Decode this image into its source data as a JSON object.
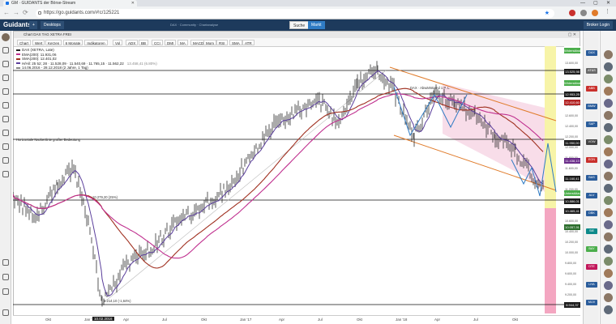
{
  "browser": {
    "tab_title": "GM · GUIDANTS der Börse-Stream",
    "url": "https://go.guidants.com/#!c/125221",
    "ctl_min": "—",
    "ctl_max": "▢",
    "ctl_close": "✕",
    "nav_back": "←",
    "nav_fwd": "→",
    "nav_reload": "⟳",
    "star": "★"
  },
  "app": {
    "logo": "Guidants",
    "add": "+",
    "desktops": "Desktops",
    "notice": "DAX · Community · Chartanalyse",
    "search": "Suche",
    "market": "Markt",
    "broker": "Broker Login"
  },
  "chart": {
    "window_title": "Chart DAX TAG XETRA FREI",
    "win_controls": "▢ ✕",
    "toolbar": [
      "Chart",
      "Wert",
      "Kerzen",
      "6 Monate",
      "Indikatoren",
      "Vol",
      "ADX",
      "BB",
      "CCI",
      "DMI",
      "MA",
      "MACD",
      "Mom",
      "RSI",
      "SMA",
      "ATR"
    ],
    "legend": {
      "name": "DAX (XETRA, Late)",
      "ema200": "EMA(200): 11.931,06",
      "sma200": "SMA(200): 12.401,02",
      "ohlc": "H/Hil: 25 52; 28 · 11.528,09 · 11.540,69 · 11.765,15 · 11.562,22",
      "period": "14.06.2016 - 28.12.2018 (2 Jahre, 1 Tag)",
      "extra": "13.458,41 (6.80%)"
    },
    "annotations": {
      "resistance": "Horizontale Nackenlinie großer Bedeutung",
      "channel": "DAX · Abwärtstrend 1 P. L.",
      "low_label": "9.214,10 (-1,64%)",
      "mid_label": "10.279,20 (25%)",
      "date_label": "10.02.2016"
    },
    "x_labels": [
      "Okt",
      "Jan '16",
      "Apr",
      "Jul",
      "Okt",
      "Jan '17",
      "Apr",
      "Jul",
      "Okt",
      "Jan '18",
      "Apr",
      "Jul",
      "Okt"
    ],
    "price_tags": [
      {
        "label": "Widerstände",
        "color": "#4cae4c"
      },
      {
        "label": "13.525,98",
        "color": "#1d1d1d"
      },
      {
        "label": "Widerstände",
        "color": "#4cae4c"
      },
      {
        "label": "12.953,25",
        "color": "#1d1d1d"
      },
      {
        "label": "12.410,60",
        "color": "#b32424"
      },
      {
        "label": "11.950,00",
        "color": "#1d1d1d"
      },
      {
        "label": "11.438,13",
        "color": "#6b2e8a"
      },
      {
        "label": "11.160,41",
        "color": "#1d1d1d"
      },
      {
        "label": "Unterstützung",
        "color": "#4cae4c"
      },
      {
        "label": "10.886,01",
        "color": "#1d1d1d"
      },
      {
        "label": "10.465,41",
        "color": "#1d1d1d"
      },
      {
        "label": "10.057,91",
        "color": "#2d6e2d"
      },
      {
        "label": "8.944,37",
        "color": "#1d1d1d"
      }
    ],
    "scale_ticks": [
      "13.800,00",
      "13.600,00",
      "13.400,00",
      "13.200,00",
      "13.000,00",
      "12.800,00",
      "12.600,00",
      "12.400,00",
      "12.200,00",
      "12.000,00",
      "11.800,00",
      "11.600,00",
      "11.400,00",
      "11.200,00",
      "11.000,00",
      "10.800,00",
      "10.600,00",
      "10.400,00",
      "10.200,00",
      "10.000,00",
      "9.800,00",
      "9.600,00",
      "9.400,00",
      "9.200,00",
      "9.000,00"
    ]
  },
  "watch": {
    "logos": [
      {
        "label": "DAX",
        "color": "#2b5d9b"
      },
      {
        "label": "AT&S",
        "color": "#6a6a6a"
      },
      {
        "label": "ABB",
        "color": "#c9302c"
      },
      {
        "label": "BMW",
        "color": "#2b5d9b"
      },
      {
        "label": "SAP",
        "color": "#2b5d9b"
      },
      {
        "label": "VOW",
        "color": "#444"
      },
      {
        "label": "EON",
        "color": "#c9302c"
      },
      {
        "label": "BAS",
        "color": "#2b5d9b"
      },
      {
        "label": "ALV",
        "color": "#2b5d9b"
      },
      {
        "label": "DBK",
        "color": "#2b5d9b"
      },
      {
        "label": "SIE",
        "color": "#0e8a8a"
      },
      {
        "label": "BAY",
        "color": "#4cae4c"
      },
      {
        "label": "DTE",
        "color": "#c2185b"
      },
      {
        "label": "LHA",
        "color": "#2b5d9b"
      },
      {
        "label": "MUV",
        "color": "#2b5d9b"
      }
    ]
  }
}
